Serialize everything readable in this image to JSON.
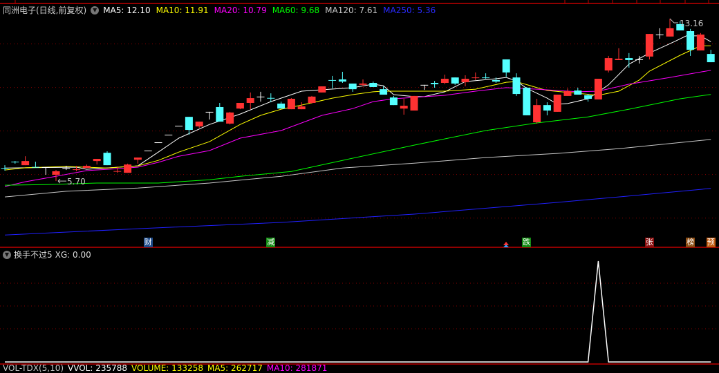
{
  "header": {
    "title": "同洲电子(日线,前复权)",
    "ma_labels": [
      {
        "text": "MA5: 12.10",
        "color": "#ffffff"
      },
      {
        "text": "MA10: 11.91",
        "color": "#ffff00"
      },
      {
        "text": "MA20: 10.79",
        "color": "#ff00ff"
      },
      {
        "text": "MA60: 9.68",
        "color": "#00ff00"
      },
      {
        "text": "MA120: 7.61",
        "color": "#c8c8c8"
      },
      {
        "text": "MA250: 5.36",
        "color": "#2a2aff"
      }
    ]
  },
  "indicator": {
    "title": "换手不过5",
    "value_label": "XG: 0.00"
  },
  "volume_bar": [
    {
      "text": "VOL-TDX(5,10)",
      "color": "#c8c8c8"
    },
    {
      "text": "VVOL: 235788",
      "color": "#ffffff"
    },
    {
      "text": "VOLUME: 133258",
      "color": "#ffff00"
    },
    {
      "text": "MA5: 262717",
      "color": "#ffff00"
    },
    {
      "text": "MA10: 281871",
      "color": "#ff00ff"
    }
  ],
  "signals": [
    {
      "text": "财",
      "bar": 14,
      "bg": "#1c4a8a"
    },
    {
      "text": "减",
      "bar": 26,
      "bg": "#138a13"
    },
    {
      "text": "跌",
      "bar": 51,
      "bg": "#138a13"
    },
    {
      "text": "张",
      "bar": 63,
      "bg": "#8a1010"
    },
    {
      "text": "榜",
      "bar": 67,
      "bg": "#8a4a10"
    },
    {
      "text": "预",
      "bar": 69,
      "bg": "#c05a10"
    }
  ],
  "colors": {
    "up": "#ff3232",
    "down": "#54ffff",
    "flat": "#ffffff",
    "grid": "#8a0000",
    "divider": "#c00000"
  },
  "chart_data": [
    {
      "type": "candlestick",
      "title": "同洲电子(日线,前复权)",
      "ylim": [
        3.07,
        13.32
      ],
      "grid": true,
      "gridlines": [
        4,
        6,
        8,
        10,
        12
      ],
      "ohlc_fields": [
        "open",
        "high",
        "low",
        "close"
      ],
      "candles": [
        [
          6.3,
          6.43,
          6.18,
          6.29
        ],
        [
          6.59,
          6.62,
          6.5,
          6.58
        ],
        [
          6.43,
          6.84,
          6.43,
          6.62
        ],
        [
          6.35,
          6.59,
          6.34,
          6.34
        ],
        [
          6.34,
          6.34,
          5.99,
          6.34
        ],
        [
          5.99,
          6.21,
          5.7,
          6.15
        ],
        [
          6.3,
          6.4,
          6.21,
          6.3
        ],
        [
          6.23,
          6.4,
          6.15,
          6.24
        ],
        [
          6.3,
          6.46,
          6.3,
          6.4
        ],
        [
          6.62,
          6.72,
          6.46,
          6.72
        ],
        [
          7.0,
          7.07,
          6.43,
          6.43
        ],
        [
          6.15,
          6.37,
          6.08,
          6.16
        ],
        [
          6.08,
          6.5,
          6.08,
          6.46
        ],
        [
          6.68,
          6.78,
          6.5,
          6.78
        ],
        [
          7.1,
          7.1,
          7.1,
          7.1
        ],
        [
          7.48,
          7.48,
          7.48,
          7.48
        ],
        [
          7.83,
          7.83,
          7.83,
          7.83
        ],
        [
          8.24,
          8.24,
          8.24,
          8.24
        ],
        [
          8.65,
          8.65,
          7.83,
          8.05
        ],
        [
          8.21,
          8.43,
          8.15,
          8.43
        ],
        [
          8.88,
          8.88,
          8.53,
          8.88
        ],
        [
          9.1,
          9.29,
          8.43,
          8.43
        ],
        [
          8.34,
          8.88,
          8.3,
          8.85
        ],
        [
          9.03,
          9.29,
          9.0,
          9.29
        ],
        [
          9.29,
          9.77,
          9.0,
          9.51
        ],
        [
          9.58,
          9.8,
          9.35,
          9.58
        ],
        [
          9.52,
          9.73,
          9.32,
          9.51
        ],
        [
          9.26,
          9.35,
          9.03,
          9.03
        ],
        [
          9.0,
          9.51,
          9.0,
          9.48
        ],
        [
          9.0,
          9.32,
          9.0,
          9.13
        ],
        [
          9.29,
          9.61,
          9.26,
          9.58
        ],
        [
          9.77,
          10.05,
          9.77,
          10.05
        ],
        [
          10.34,
          10.53,
          9.96,
          10.33
        ],
        [
          10.37,
          10.72,
          10.21,
          10.27
        ],
        [
          10.18,
          10.18,
          9.8,
          9.92
        ],
        [
          10.12,
          10.37,
          10.05,
          10.18
        ],
        [
          10.21,
          10.27,
          10.02,
          10.02
        ],
        [
          9.92,
          10.05,
          9.67,
          9.67
        ],
        [
          9.54,
          9.61,
          9.19,
          9.19
        ],
        [
          9.03,
          9.48,
          8.75,
          9.16
        ],
        [
          8.94,
          9.61,
          8.94,
          9.61
        ],
        [
          10.12,
          10.12,
          9.89,
          10.12
        ],
        [
          10.21,
          10.3,
          9.99,
          10.15
        ],
        [
          10.21,
          10.59,
          10.15,
          10.4
        ],
        [
          10.46,
          10.46,
          10.12,
          10.18
        ],
        [
          10.24,
          10.56,
          10.05,
          10.4
        ],
        [
          10.45,
          10.69,
          10.34,
          10.46
        ],
        [
          10.46,
          10.65,
          10.4,
          10.45
        ],
        [
          10.34,
          10.46,
          10.21,
          10.27
        ],
        [
          11.29,
          11.29,
          10.49,
          10.69
        ],
        [
          10.46,
          10.65,
          9.61,
          9.7
        ],
        [
          9.99,
          10.02,
          8.72,
          8.72
        ],
        [
          8.4,
          9.48,
          8.34,
          9.19
        ],
        [
          9.19,
          9.32,
          8.72,
          8.94
        ],
        [
          8.88,
          9.67,
          8.88,
          9.67
        ],
        [
          9.61,
          9.96,
          9.61,
          9.83
        ],
        [
          9.86,
          9.99,
          9.67,
          9.67
        ],
        [
          9.64,
          9.7,
          9.35,
          9.48
        ],
        [
          9.45,
          10.4,
          9.45,
          10.4
        ],
        [
          10.78,
          11.45,
          10.69,
          11.35
        ],
        [
          11.26,
          11.8,
          11.26,
          11.32
        ],
        [
          11.35,
          11.58,
          10.91,
          11.26
        ],
        [
          11.29,
          11.45,
          11.1,
          11.29
        ],
        [
          11.42,
          12.46,
          11.29,
          12.46
        ],
        [
          12.43,
          12.72,
          12.24,
          12.43
        ],
        [
          12.34,
          13.16,
          12.34,
          12.72
        ],
        [
          12.91,
          13.04,
          12.62,
          12.62
        ],
        [
          12.59,
          12.69,
          11.45,
          11.73
        ],
        [
          11.7,
          12.5,
          11.7,
          12.43
        ],
        [
          11.54,
          11.73,
          11.16,
          11.16
        ]
      ],
      "series": [
        {
          "name": "MA5",
          "color": "#ffffff",
          "points": [
            [
              0,
              6.3
            ],
            [
              7,
              6.34
            ],
            [
              8,
              6.24
            ],
            [
              13,
              6.4
            ],
            [
              15,
              7.03
            ],
            [
              17,
              7.67
            ],
            [
              20,
              8.3
            ],
            [
              23,
              8.78
            ],
            [
              26,
              9.35
            ],
            [
              29,
              9.83
            ],
            [
              34,
              9.99
            ],
            [
              36,
              10.15
            ],
            [
              37,
              10.08
            ],
            [
              38,
              9.67
            ],
            [
              40,
              9.58
            ],
            [
              41,
              9.58
            ],
            [
              43,
              9.8
            ],
            [
              45,
              10.27
            ],
            [
              48,
              10.4
            ],
            [
              49,
              10.46
            ],
            [
              50,
              10.3
            ],
            [
              51,
              9.96
            ],
            [
              53,
              9.51
            ],
            [
              54,
              9.23
            ],
            [
              55,
              9.26
            ],
            [
              57,
              9.48
            ],
            [
              58,
              9.8
            ],
            [
              59,
              10.12
            ],
            [
              61,
              11.07
            ],
            [
              63,
              11.58
            ],
            [
              65.5,
              12.12
            ],
            [
              66.6,
              12.37
            ],
            [
              68,
              12.37
            ],
            [
              69,
              12.1
            ]
          ]
        },
        {
          "name": "MA10",
          "color": "#ffff00",
          "points": [
            [
              0,
              6.21
            ],
            [
              2,
              6.31
            ],
            [
              6,
              6.37
            ],
            [
              10,
              6.3
            ],
            [
              13,
              6.4
            ],
            [
              15,
              6.65
            ],
            [
              17,
              7.03
            ],
            [
              20,
              7.51
            ],
            [
              23,
              8.3
            ],
            [
              25,
              8.72
            ],
            [
              27,
              9.0
            ],
            [
              29,
              9.19
            ],
            [
              32,
              9.51
            ],
            [
              34,
              9.67
            ],
            [
              36,
              9.8
            ],
            [
              37,
              9.83
            ],
            [
              43,
              9.83
            ],
            [
              46,
              9.92
            ],
            [
              49,
              10.24
            ],
            [
              50,
              10.27
            ],
            [
              52,
              9.99
            ],
            [
              53,
              9.86
            ],
            [
              56,
              9.73
            ],
            [
              58,
              9.64
            ],
            [
              60,
              9.83
            ],
            [
              62,
              10.34
            ],
            [
              63,
              10.75
            ],
            [
              66,
              11.48
            ],
            [
              68,
              11.91
            ],
            [
              69,
              11.91
            ]
          ]
        },
        {
          "name": "MA20",
          "color": "#ff00ff",
          "points": [
            [
              0,
              5.45
            ],
            [
              2,
              5.67
            ],
            [
              5,
              5.92
            ],
            [
              8,
              6.18
            ],
            [
              11,
              6.27
            ],
            [
              13,
              6.34
            ],
            [
              15,
              6.56
            ],
            [
              17,
              6.84
            ],
            [
              20,
              7.1
            ],
            [
              23,
              7.67
            ],
            [
              27,
              8.02
            ],
            [
              31,
              8.72
            ],
            [
              34,
              9.03
            ],
            [
              36,
              9.35
            ],
            [
              38,
              9.48
            ],
            [
              43,
              9.64
            ],
            [
              46,
              9.83
            ],
            [
              49,
              9.99
            ],
            [
              52,
              9.92
            ],
            [
              56,
              9.8
            ],
            [
              58,
              9.83
            ],
            [
              61,
              10.15
            ],
            [
              65,
              10.46
            ],
            [
              69,
              10.79
            ]
          ]
        },
        {
          "name": "MA60",
          "color": "#00ff00",
          "points": [
            [
              0,
              5.51
            ],
            [
              4,
              5.54
            ],
            [
              9,
              5.61
            ],
            [
              15,
              5.61
            ],
            [
              20,
              5.76
            ],
            [
              23,
              5.92
            ],
            [
              28,
              6.14
            ],
            [
              33,
              6.65
            ],
            [
              40,
              7.35
            ],
            [
              47,
              8.02
            ],
            [
              52,
              8.37
            ],
            [
              57,
              8.65
            ],
            [
              61,
              9.0
            ],
            [
              66,
              9.48
            ],
            [
              69,
              9.68
            ]
          ]
        },
        {
          "name": "MA120",
          "color": "#c8c8c8",
          "points": [
            [
              0,
              4.97
            ],
            [
              6,
              5.23
            ],
            [
              13,
              5.38
            ],
            [
              20,
              5.61
            ],
            [
              27,
              5.92
            ],
            [
              33,
              6.3
            ],
            [
              40,
              6.52
            ],
            [
              47,
              6.78
            ],
            [
              54,
              6.97
            ],
            [
              60,
              7.19
            ],
            [
              69,
              7.61
            ]
          ]
        },
        {
          "name": "MA250",
          "color": "#2020ff",
          "points": [
            [
              0,
              3.22
            ],
            [
              13,
              3.51
            ],
            [
              27,
              3.8
            ],
            [
              40,
              4.18
            ],
            [
              54,
              4.72
            ],
            [
              60,
              4.97
            ],
            [
              69,
              5.36
            ]
          ]
        }
      ],
      "annotations": [
        {
          "text": "13.16",
          "bar": 65,
          "price": 13.16,
          "kind": "high"
        },
        {
          "text": "5.70",
          "bar": 5,
          "price": 5.7,
          "kind": "low"
        }
      ]
    },
    {
      "type": "line",
      "title": "换手不过5",
      "series": [
        {
          "name": "XG",
          "color": "#ffffff",
          "points": [
            [
              0,
              0
            ],
            [
              57,
              0
            ],
            [
              58,
              1
            ],
            [
              59,
              0
            ],
            [
              69,
              0
            ]
          ]
        }
      ],
      "ylim": [
        0,
        1
      ]
    }
  ]
}
